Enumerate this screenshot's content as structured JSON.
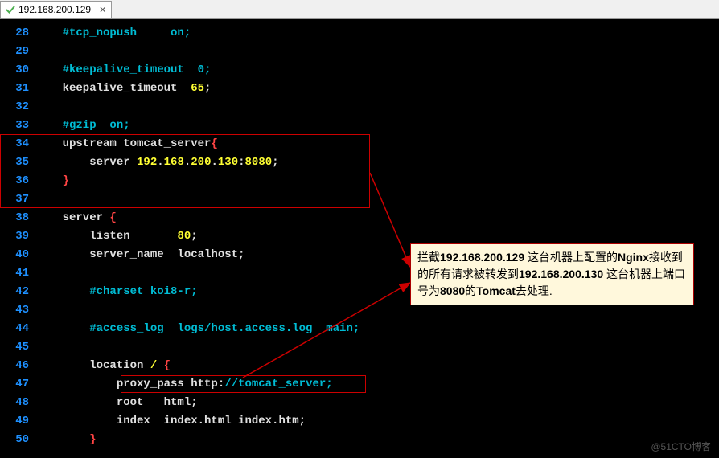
{
  "tab": {
    "title": "192.168.200.129",
    "icon": "check-icon"
  },
  "lines": [
    {
      "num": "28",
      "segments": [
        {
          "cls": "c-teal",
          "text": "    #tcp_nopush     on;"
        }
      ]
    },
    {
      "num": "29",
      "segments": []
    },
    {
      "num": "30",
      "segments": [
        {
          "cls": "c-teal",
          "text": "    #keepalive_timeout  0;"
        }
      ]
    },
    {
      "num": "31",
      "segments": [
        {
          "cls": "c-white",
          "text": "    keepalive_timeout  "
        },
        {
          "cls": "c-yellow",
          "text": "65"
        },
        {
          "cls": "c-white",
          "text": ";"
        }
      ]
    },
    {
      "num": "32",
      "segments": []
    },
    {
      "num": "33",
      "segments": [
        {
          "cls": "c-teal",
          "text": "    #gzip  on;"
        }
      ]
    },
    {
      "num": "34",
      "segments": [
        {
          "cls": "c-white",
          "text": "    upstream tomcat_server"
        },
        {
          "cls": "c-red",
          "text": "{"
        }
      ]
    },
    {
      "num": "35",
      "segments": [
        {
          "cls": "c-white",
          "text": "        server "
        },
        {
          "cls": "c-yellow",
          "text": "192"
        },
        {
          "cls": "c-white",
          "text": "."
        },
        {
          "cls": "c-yellow",
          "text": "168"
        },
        {
          "cls": "c-white",
          "text": "."
        },
        {
          "cls": "c-yellow",
          "text": "200"
        },
        {
          "cls": "c-white",
          "text": "."
        },
        {
          "cls": "c-yellow",
          "text": "130"
        },
        {
          "cls": "c-white",
          "text": ":"
        },
        {
          "cls": "c-yellow",
          "text": "8080"
        },
        {
          "cls": "c-white",
          "text": ";"
        }
      ]
    },
    {
      "num": "36",
      "segments": [
        {
          "cls": "c-red",
          "text": "    }"
        }
      ]
    },
    {
      "num": "37",
      "segments": []
    },
    {
      "num": "38",
      "segments": [
        {
          "cls": "c-white",
          "text": "    server "
        },
        {
          "cls": "c-red",
          "text": "{"
        }
      ]
    },
    {
      "num": "39",
      "segments": [
        {
          "cls": "c-white",
          "text": "        listen       "
        },
        {
          "cls": "c-yellow",
          "text": "80"
        },
        {
          "cls": "c-white",
          "text": ";"
        }
      ]
    },
    {
      "num": "40",
      "segments": [
        {
          "cls": "c-white",
          "text": "        server_name  localhost;"
        }
      ]
    },
    {
      "num": "41",
      "segments": []
    },
    {
      "num": "42",
      "segments": [
        {
          "cls": "c-teal",
          "text": "        #charset koi8-r;"
        }
      ]
    },
    {
      "num": "43",
      "segments": []
    },
    {
      "num": "44",
      "segments": [
        {
          "cls": "c-teal",
          "text": "        #access_log  logs/host.access.log  main;"
        }
      ]
    },
    {
      "num": "45",
      "segments": []
    },
    {
      "num": "46",
      "segments": [
        {
          "cls": "c-white",
          "text": "        location "
        },
        {
          "cls": "c-yellow",
          "text": "/"
        },
        {
          "cls": "c-white",
          "text": " "
        },
        {
          "cls": "c-red",
          "text": "{"
        }
      ]
    },
    {
      "num": "47",
      "segments": [
        {
          "cls": "c-white",
          "text": "            proxy_pass http:"
        },
        {
          "cls": "c-teal",
          "text": "//tomcat_server;"
        }
      ]
    },
    {
      "num": "48",
      "segments": [
        {
          "cls": "c-white",
          "text": "            root   html;"
        }
      ]
    },
    {
      "num": "49",
      "segments": [
        {
          "cls": "c-white",
          "text": "            index  index.html index.htm;"
        }
      ]
    },
    {
      "num": "50",
      "segments": [
        {
          "cls": "c-red",
          "text": "        }"
        }
      ]
    }
  ],
  "annotation": {
    "parts": [
      {
        "bold": false,
        "text": "拦截"
      },
      {
        "bold": true,
        "text": "192.168.200.129 "
      },
      {
        "bold": false,
        "text": "这台机器上配置的"
      },
      {
        "bold": true,
        "text": "Nginx"
      },
      {
        "bold": false,
        "text": "接收到的所有请求被转发到"
      },
      {
        "bold": true,
        "text": "192.168.200.130 "
      },
      {
        "bold": false,
        "text": "这台机器上端口号为"
      },
      {
        "bold": true,
        "text": "8080"
      },
      {
        "bold": false,
        "text": "的"
      },
      {
        "bold": true,
        "text": "Tomcat"
      },
      {
        "bold": false,
        "text": "去处理."
      }
    ]
  },
  "watermark": "@51CTO博客"
}
